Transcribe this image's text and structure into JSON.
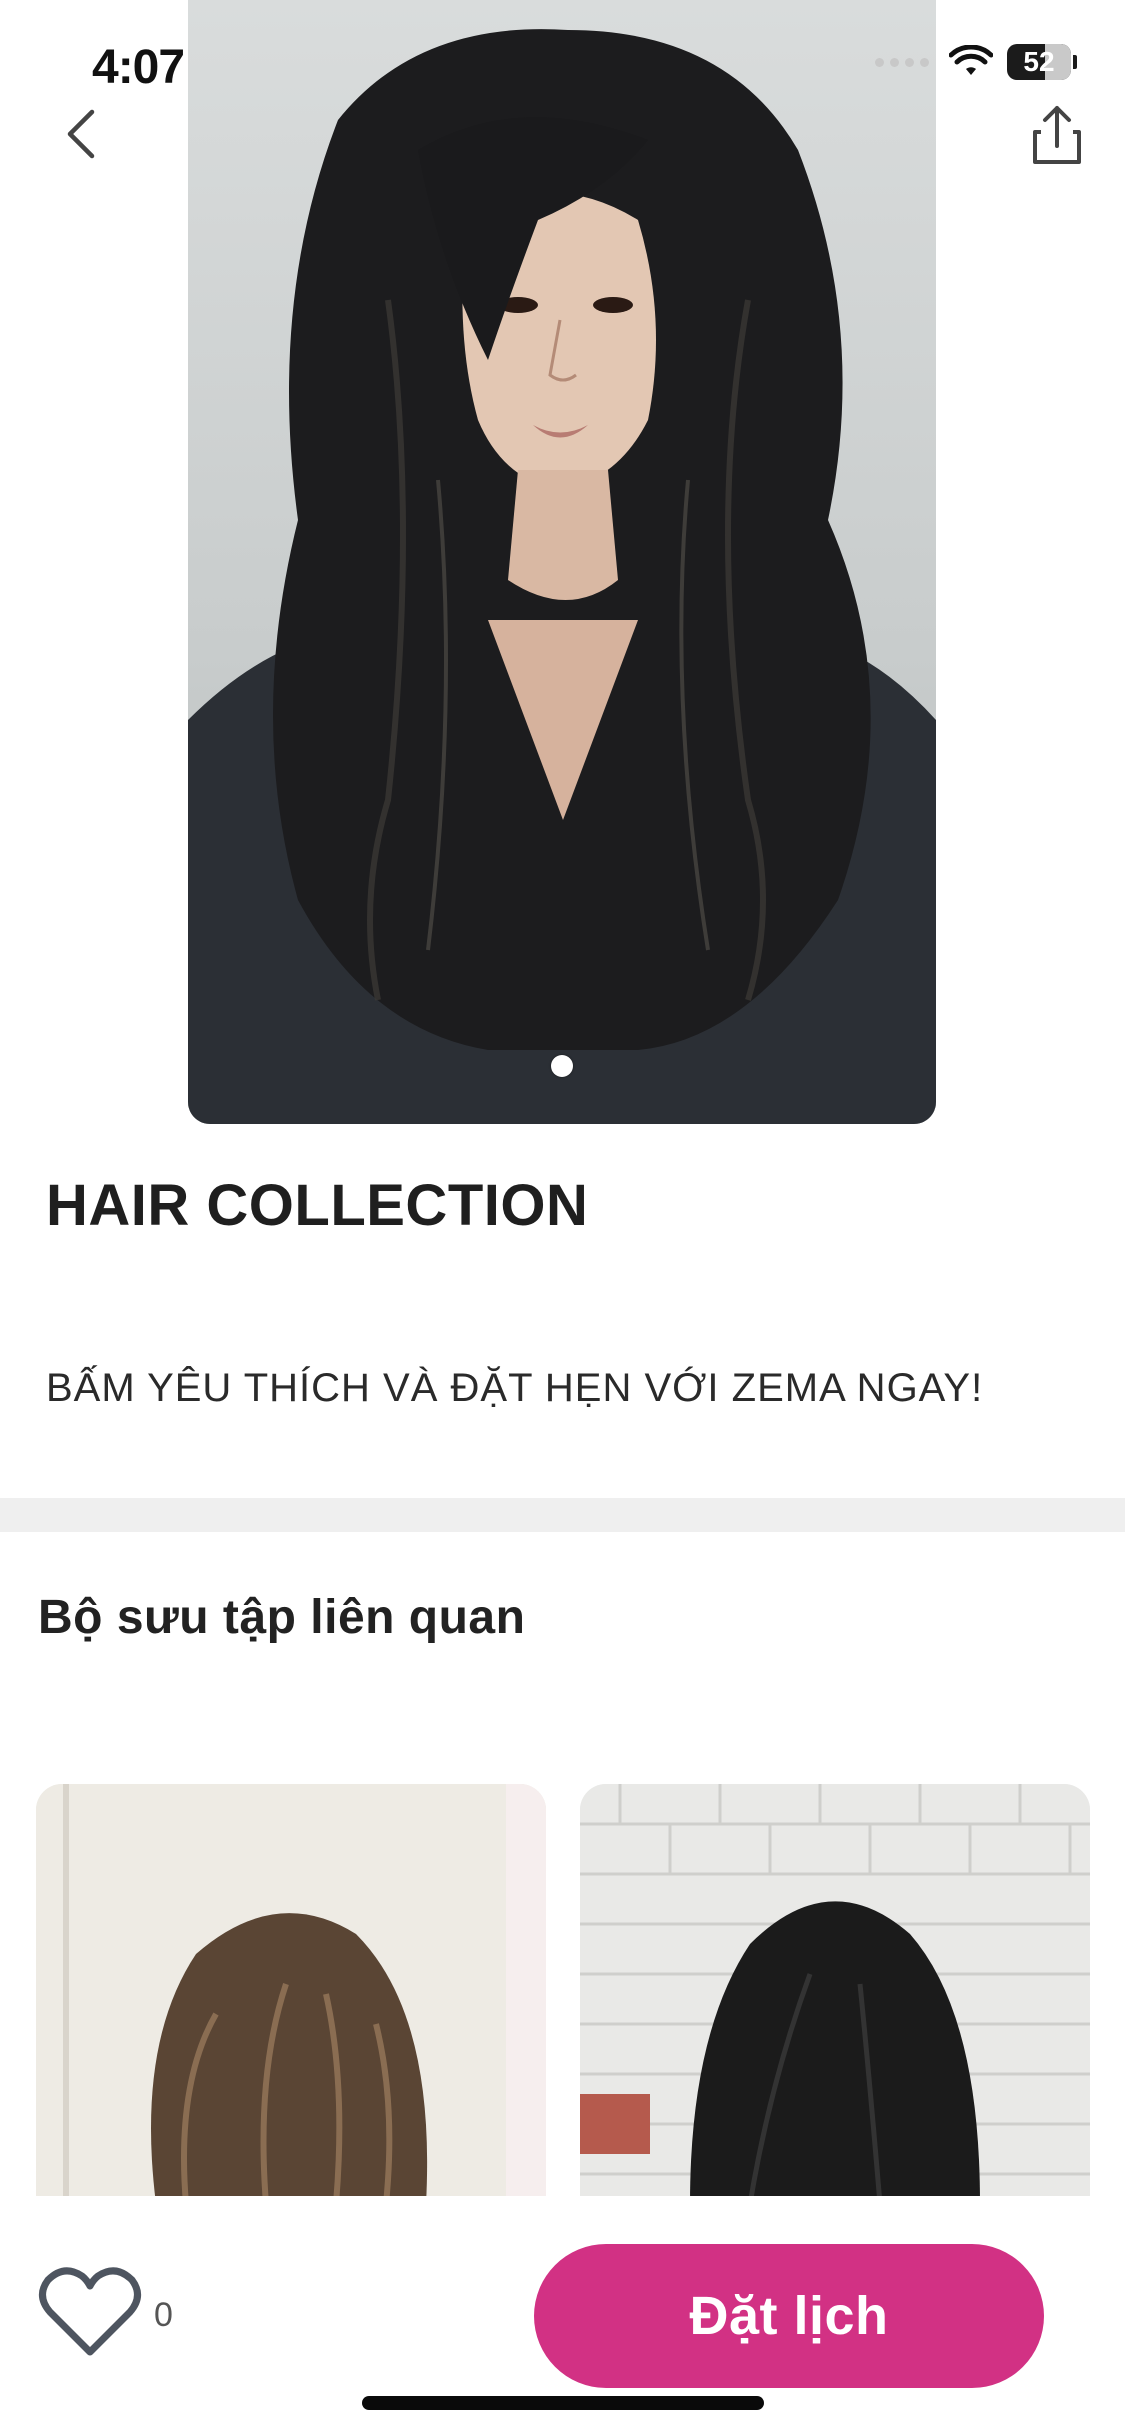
{
  "status_bar": {
    "time": "4:07",
    "battery": "52"
  },
  "hero": {
    "image_subject": "portrait of a woman with long layered dark hair",
    "pager_dots": 1
  },
  "content": {
    "title": "HAIR COLLECTION",
    "subtitle": "BẤM YÊU THÍCH VÀ ĐẶT HẸN VỚI ZEMA NGAY!",
    "related_heading": "Bộ sưu tập liên quan"
  },
  "related": [
    {
      "image_subject": "wavy brown medium-length hair, back view"
    },
    {
      "image_subject": "dark straight medium-length hair, back view, brick wall"
    }
  ],
  "bottom_bar": {
    "like_count": "0",
    "book_label": "Đặt lịch"
  },
  "colors": {
    "accent": "#d23184",
    "divider": "#efefef"
  },
  "icons": [
    "back-chevron-icon",
    "share-icon",
    "heart-icon",
    "wifi-icon",
    "battery-icon"
  ]
}
